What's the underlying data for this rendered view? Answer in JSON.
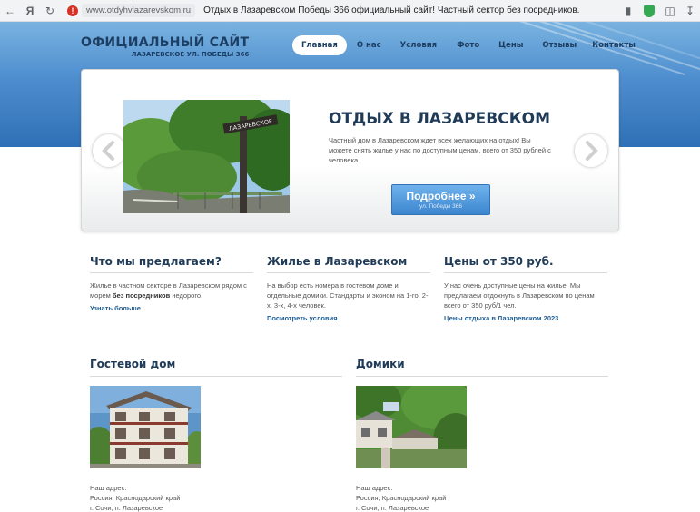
{
  "browser": {
    "url": "www.otdyhvlazarevskom.ru",
    "tab_title": "Отдых в Лазаревском Победы 366 официальный сайт! Частный сектор без посредников."
  },
  "site": {
    "logo_title": "ОФИЦИАЛЬНЫЙ САЙТ",
    "logo_subtitle": "ЛАЗАРЕВСКОЕ УЛ. ПОБЕДЫ 366"
  },
  "nav": {
    "items": [
      {
        "label": "Главная",
        "active": true
      },
      {
        "label": "О нас"
      },
      {
        "label": "Условия"
      },
      {
        "label": "Фото"
      },
      {
        "label": "Цены"
      },
      {
        "label": "Отзывы"
      },
      {
        "label": "Контакты"
      }
    ]
  },
  "slider": {
    "title": "ОТДЫХ В ЛАЗАРЕВСКОМ",
    "text": "Частный дом в Лазаревском ждет всех желающих на отдых! Вы можете снять жилье у нас по доступным ценам, всего от 350 рублей с человека",
    "sign_text": "ЛАЗАРЕВСКОЕ",
    "button_label": "Подробнее »",
    "button_sub": "ул. Победы 366"
  },
  "features": [
    {
      "title": "Что мы предлагаем?",
      "text_before": "Жилье в частном секторе в Лазаревском рядом с морем ",
      "text_bold": "без посредников",
      "text_after": " недорого.",
      "link": "Узнать больше"
    },
    {
      "title": "Жилье в Лазаревском",
      "text": "На выбор есть номера в гостевом доме и отдельные домики. Стандарты и эконом на 1-го, 2-х, 3-х, 4-х человек.",
      "link": "Посмотреть условия"
    },
    {
      "title": "Цены от 350 руб.",
      "text": "У нас очень доступные цены на жилье. Мы предлагаем отдохнуть в Лазаревском по ценам всего от 350 руб/1 чел.",
      "link": "Цены отдыха в Лазаревском 2023"
    }
  ],
  "listings": [
    {
      "title": "Гостевой дом",
      "address_label": "Наш адрес:",
      "address_line1": "Россия, Краснодарский край",
      "address_line2": "г. Сочи, п. Лазаревское"
    },
    {
      "title": "Домики",
      "address_label": "Наш адрес:",
      "address_line1": "Россия, Краснодарский край",
      "address_line2": "г. Сочи, п. Лазаревское"
    }
  ],
  "colors": {
    "header_blue": "#4e8ecf",
    "heading_dark": "#1f3b57",
    "link_blue": "#1e5d94",
    "button_blue": "#3c86cf"
  }
}
